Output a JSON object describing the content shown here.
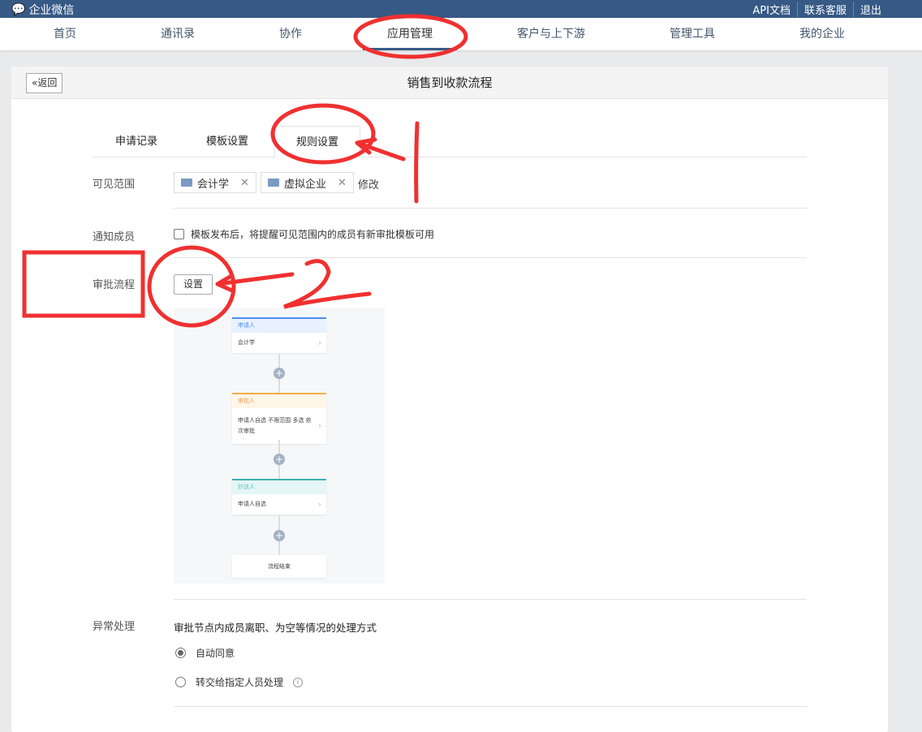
{
  "topbar": {
    "logo": "企业微信",
    "links": [
      "API文档",
      "联系客服",
      "退出"
    ]
  },
  "nav": {
    "items": [
      "首页",
      "通讯录",
      "协作",
      "应用管理",
      "客户与上下游",
      "管理工具",
      "我的企业"
    ],
    "active": "应用管理"
  },
  "page": {
    "back": "返回",
    "title": "销售到收款流程"
  },
  "tabs": [
    "申请记录",
    "模板设置",
    "规则设置"
  ],
  "visible_scope": {
    "label": "可见范围",
    "tags": [
      "会计学",
      "虚拟企业"
    ],
    "edit": "修改"
  },
  "notify": {
    "label": "通知成员",
    "text": "模板发布后，将提醒可见范围内的成员有新审批模板可用",
    "checked": false
  },
  "approval": {
    "label": "审批流程",
    "button": "设置",
    "flow": {
      "applicant_title": "申请人",
      "applicant_value": "会计学",
      "approver_title": "审批人",
      "approver_value": "申请人自选 不限范围 多选 依次审批",
      "cc_title": "抄送人",
      "cc_value": "申请人自选",
      "end": "流程结束"
    }
  },
  "exception": {
    "label": "异常处理",
    "desc": "审批节点内成员离职、为空等情况的处理方式",
    "options": [
      "自动同意",
      "转交给指定人员处理"
    ],
    "selected": 0
  },
  "colors": {
    "topbar": "#365a85",
    "annotation": "#f03030"
  }
}
